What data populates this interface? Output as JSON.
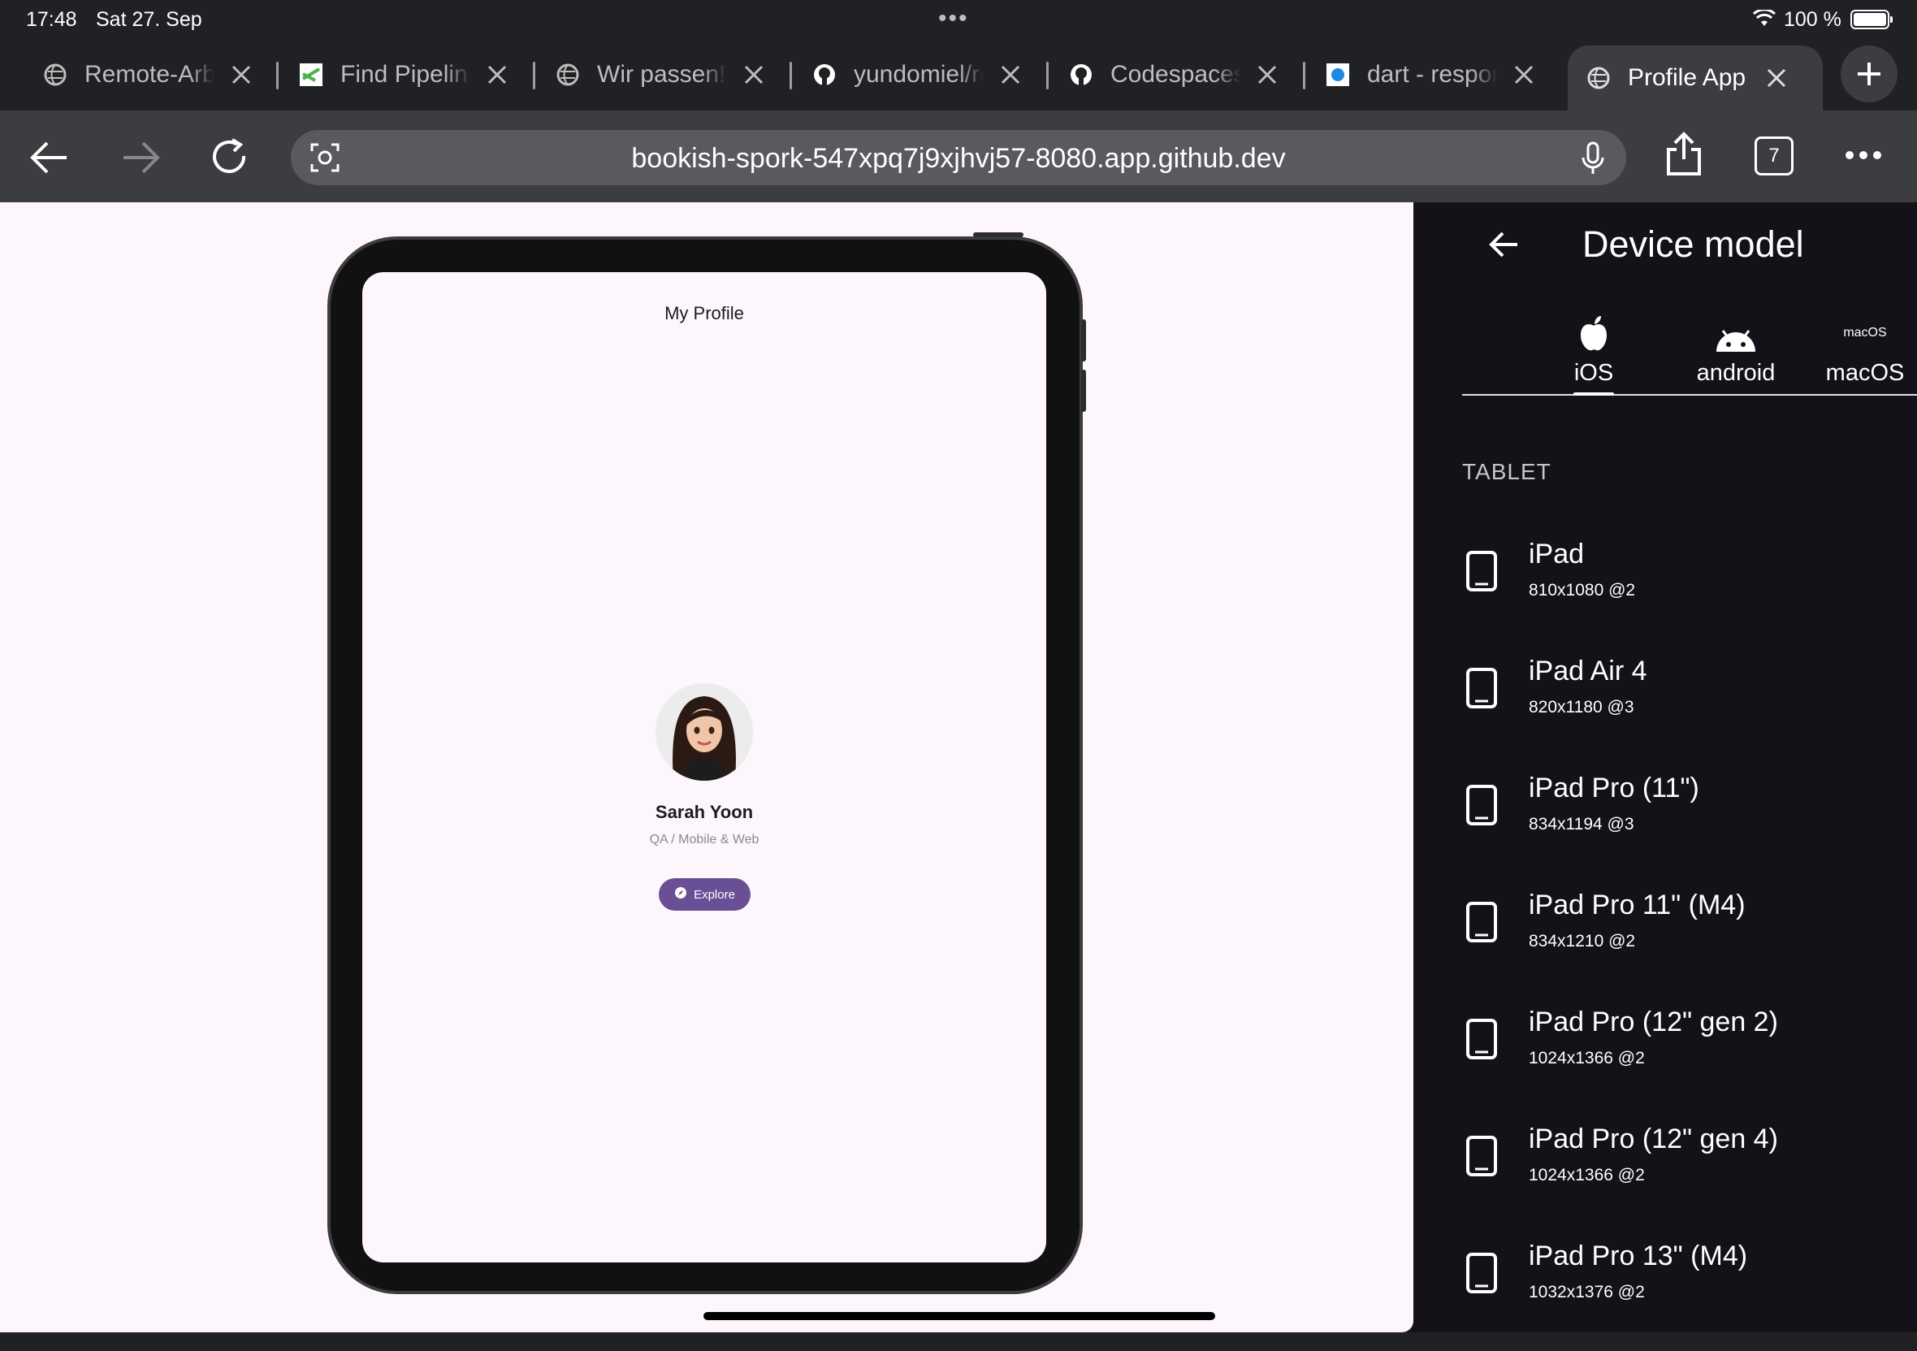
{
  "status_bar": {
    "time": "17:48",
    "date": "Sat 27. Sep",
    "battery": "100 %"
  },
  "tabs": [
    {
      "title": "Remote-Arbeit",
      "favicon": "globe-icon"
    },
    {
      "title": "Find Pipeline",
      "favicon": "site-logo-icon"
    },
    {
      "title": "Wir passen!",
      "favicon": "globe-icon"
    },
    {
      "title": "yundomiel/responsive",
      "favicon": "github-icon"
    },
    {
      "title": "Codespaces",
      "favicon": "github-icon"
    },
    {
      "title": "dart - responsive",
      "favicon": "dart-icon"
    },
    {
      "title": "Profile App",
      "favicon": "globe-icon",
      "active": true
    }
  ],
  "toolbar": {
    "url": "bookish-spork-547xpq7j9xjhvj57-8080.app.github.dev",
    "tab_count": "7"
  },
  "preview": {
    "app_title": "My Profile",
    "profile_name": "Sarah Yoon",
    "profile_role": "QA / Mobile & Web",
    "explore_label": "Explore"
  },
  "panel": {
    "title": "Device model",
    "os_tabs": [
      {
        "label": "iOS",
        "icon": "apple-icon",
        "selected": true
      },
      {
        "label": "android",
        "icon": "android-icon"
      },
      {
        "label": "macOS",
        "icon": "macos-wordmark",
        "glyph": "macOS"
      }
    ],
    "section": "TABLET",
    "devices": [
      {
        "name": "iPad",
        "res": "810x1080 @2"
      },
      {
        "name": "iPad Air 4",
        "res": "820x1180 @3"
      },
      {
        "name": "iPad Pro (11\")",
        "res": "834x1194 @3"
      },
      {
        "name": "iPad Pro 11\" (M4)",
        "res": "834x1210 @2"
      },
      {
        "name": "iPad Pro (12\" gen 2)",
        "res": "1024x1366 @2"
      },
      {
        "name": "iPad Pro (12\" gen 4)",
        "res": "1024x1366 @2"
      },
      {
        "name": "iPad Pro 13\" (M4)",
        "res": "1032x1376 @2"
      }
    ]
  },
  "colors": {
    "accent": "#6a4f96",
    "toolbar": "#3c3d40",
    "panel_bg": "#141218",
    "preview_bg": "#fdf7fd"
  }
}
